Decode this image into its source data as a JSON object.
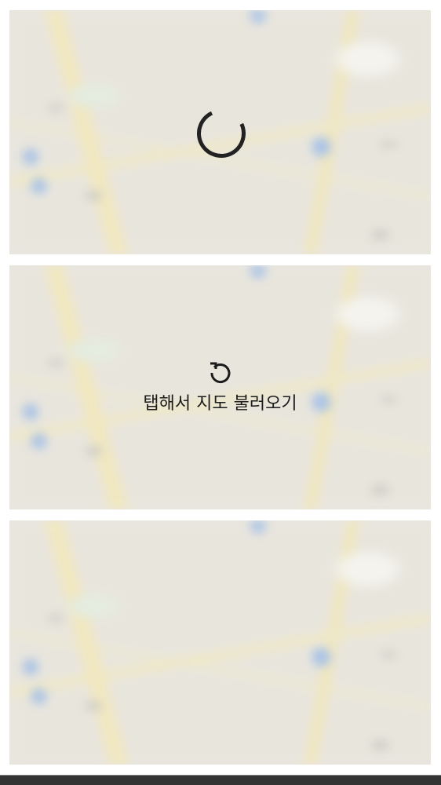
{
  "maps": [
    {
      "state": "loading",
      "icon": "spinner-icon"
    },
    {
      "state": "tap-to-load",
      "icon": "reload-icon",
      "label": "탭해서 지도 불러오기"
    },
    {
      "state": "loaded"
    }
  ],
  "colors": {
    "spinner": "#222222",
    "bottom_bar": "#333333"
  }
}
